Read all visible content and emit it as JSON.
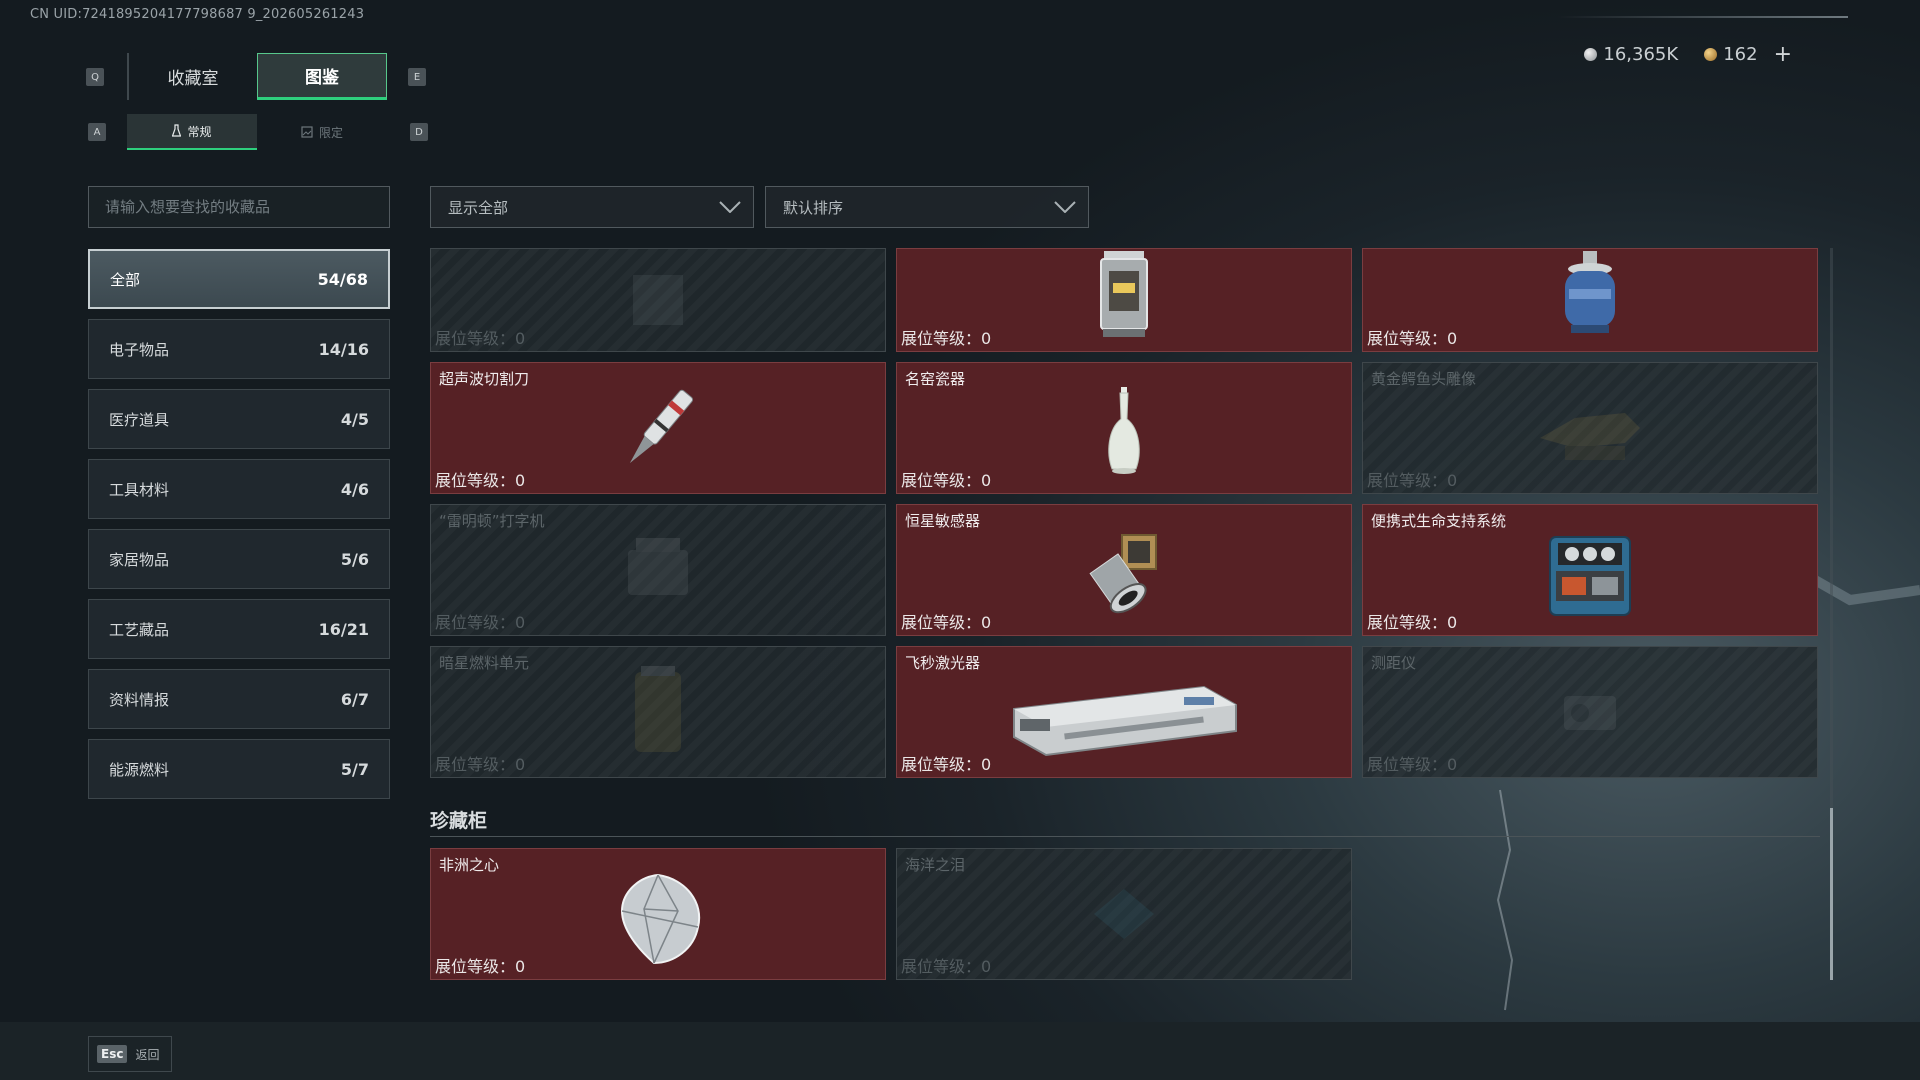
{
  "header": {
    "uid": "CN UID:7241895204177798687 9_202605261243",
    "currency": {
      "silver": "16,365K",
      "gold": "162",
      "add": "+"
    },
    "key_q": "Q",
    "key_e": "E",
    "key_a": "A",
    "key_d": "D"
  },
  "tabs": [
    {
      "label": "收藏室",
      "active": false
    },
    {
      "label": "图鉴",
      "active": true
    }
  ],
  "subtabs": [
    {
      "label": "常规",
      "active": true
    },
    {
      "label": "限定",
      "active": false
    }
  ],
  "search": {
    "placeholder": "请输入想要查找的收藏品"
  },
  "filters": {
    "show": "显示全部",
    "sort": "默认排序"
  },
  "categories": [
    {
      "label": "全部",
      "count": "54/68",
      "active": true
    },
    {
      "label": "电子物品",
      "count": "14/16"
    },
    {
      "label": "医疗道具",
      "count": "4/5"
    },
    {
      "label": "工具材料",
      "count": "4/6"
    },
    {
      "label": "家居物品",
      "count": "5/6"
    },
    {
      "label": "工艺藏品",
      "count": "16/21"
    },
    {
      "label": "资料情报",
      "count": "6/7"
    },
    {
      "label": "能源燃料",
      "count": "5/7"
    }
  ],
  "level_label": "展位等级：",
  "grid": [
    {
      "name": "",
      "level": "0",
      "owned": false,
      "icon": "partial-item-icon"
    },
    {
      "name": "",
      "level": "0",
      "owned": true,
      "icon": "lantern-icon"
    },
    {
      "name": "",
      "level": "0",
      "owned": true,
      "icon": "gas-canister-icon"
    },
    {
      "name": "超声波切割刀",
      "level": "0",
      "owned": true,
      "icon": "ultrasonic-knife-icon"
    },
    {
      "name": "名窑瓷器",
      "level": "0",
      "owned": true,
      "icon": "porcelain-vase-icon"
    },
    {
      "name": "黄金鳄鱼头雕像",
      "level": "0",
      "owned": false,
      "icon": "crocodile-statue-icon"
    },
    {
      "name": "“雷明顿”打字机",
      "level": "0",
      "owned": false,
      "icon": "typewriter-icon"
    },
    {
      "name": "恒星敏感器",
      "level": "0",
      "owned": true,
      "icon": "star-sensor-icon"
    },
    {
      "name": "便携式生命支持系统",
      "level": "0",
      "owned": true,
      "icon": "life-support-icon"
    },
    {
      "name": "暗星燃料单元",
      "level": "0",
      "owned": false,
      "icon": "fuel-cell-icon"
    },
    {
      "name": "飞秒激光器",
      "level": "0",
      "owned": true,
      "icon": "femto-laser-icon"
    },
    {
      "name": "测距仪",
      "level": "0",
      "owned": false,
      "icon": "rangefinder-icon"
    }
  ],
  "cabinet": {
    "title": "珍藏柜",
    "items": [
      {
        "name": "非洲之心",
        "level": "0",
        "owned": true,
        "icon": "diamond-icon"
      },
      {
        "name": "海洋之泪",
        "level": "0",
        "owned": false,
        "icon": "ocean-tear-icon"
      }
    ]
  },
  "footer": {
    "esc_key": "Esc",
    "esc_label": "返回"
  },
  "colors": {
    "accent": "#2ecf7d",
    "owned_bg": "#562125",
    "locked_bg": "#283034"
  }
}
